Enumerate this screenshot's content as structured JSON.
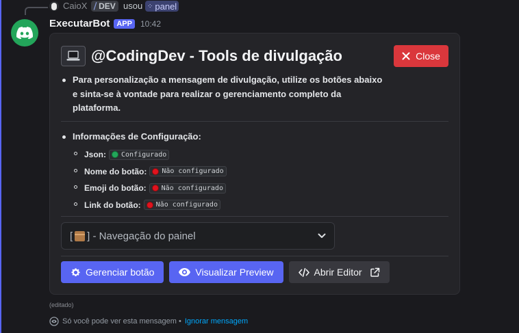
{
  "reply": {
    "user": "CaioX",
    "app_tag": "DEV",
    "action": "usou",
    "command": "panel"
  },
  "message": {
    "bot_name": "ExecutarBot",
    "badge": "APP",
    "time": "10:42",
    "edited": "(editado)"
  },
  "panel": {
    "title": "@CodingDev - Tools de divulgação",
    "close_label": "Close",
    "description_lines": [
      "Para personalização a mensagem de divulgação, utilize os botões abaixo",
      "e sinta-se à vontade para realizar o gerenciamento completo da",
      "plataforma."
    ],
    "config_heading": "Informações de Configuração:",
    "config_items": [
      {
        "label": "Json:",
        "status": "Configurado",
        "status_color": "#23a55a"
      },
      {
        "label": "Nome do botão:",
        "status": "Não configurado",
        "status_color": "#e0131e"
      },
      {
        "label": "Emoji do botão:",
        "status": "Não configurado",
        "status_color": "#e0131e"
      },
      {
        "label": "Link do botão:",
        "status": "Não configurado",
        "status_color": "#e0131e"
      }
    ],
    "select": {
      "open_bracket": "[",
      "close_bracket": "] - Navegação do painel"
    },
    "buttons": {
      "manage": "Gerenciar botão",
      "preview": "Visualizar Preview",
      "editor": "Abrir Editor"
    }
  },
  "footer": {
    "notice": "Só você pode ver esta mensagem •",
    "dismiss": "Ignorar mensagem"
  },
  "colors": {
    "accent": "#5865f2",
    "danger": "#da373c",
    "avatar": "#23a55a",
    "link": "#00a8fc"
  }
}
